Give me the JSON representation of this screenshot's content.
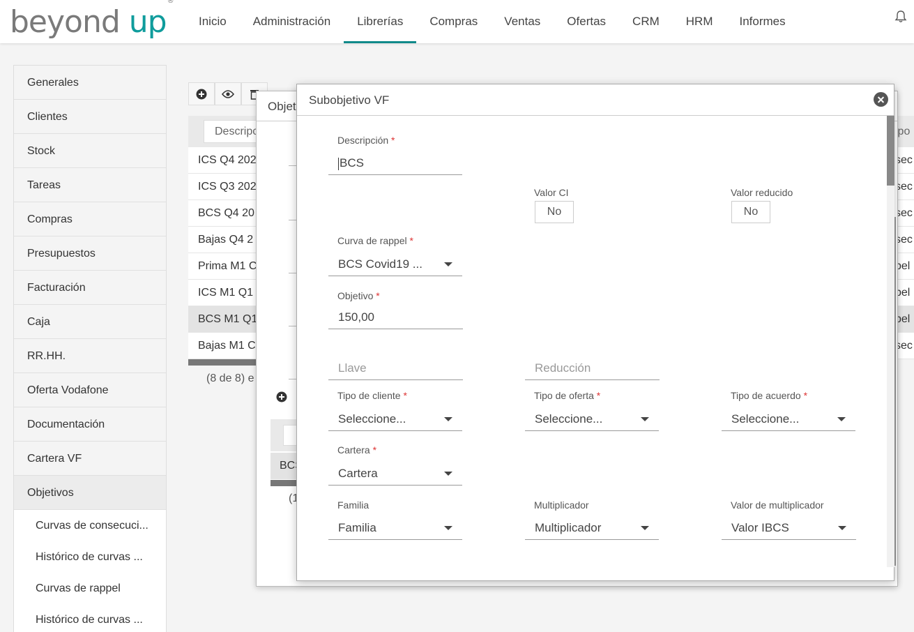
{
  "logo": {
    "part1": "beyond",
    "part2": "up",
    "mark": "®"
  },
  "nav": {
    "items": [
      "Inicio",
      "Administración",
      "Librerías",
      "Compras",
      "Ventas",
      "Ofertas",
      "CRM",
      "HRM",
      "Informes"
    ],
    "active": "Librerías"
  },
  "sidebar": {
    "items": [
      "Generales",
      "Clientes",
      "Stock",
      "Tareas",
      "Compras",
      "Presupuestos",
      "Facturación",
      "Caja",
      "RR.HH.",
      "Oferta Vodafone",
      "Documentación",
      "Cartera VF",
      "Objetivos"
    ],
    "sub_items": [
      "Curvas de consecuci...",
      "Histórico de curvas ...",
      "Curvas de rappel",
      "Histórico de curvas ..."
    ]
  },
  "background": {
    "header_label": "Descripc",
    "right_header": "ipo",
    "rows": [
      "ICS Q4 202",
      "ICS Q3 202",
      "BCS Q4 20",
      "Bajas Q4 2",
      "Prima M1 C",
      "ICS M1 Q1",
      "BCS M1 Q1",
      "Bajas M1 C"
    ],
    "right_cells": [
      "sec",
      "sec",
      "sec",
      "sec",
      "pel",
      "pel",
      "pel",
      "sec"
    ],
    "count": "(8 de 8) e"
  },
  "middle_dialog": {
    "title": "Objet",
    "sub_row": "BCS",
    "sub_count": "(1"
  },
  "dialog": {
    "title": "Subobjetivo VF",
    "required_mark": "*",
    "descripcion": {
      "label": "Descripción",
      "value": "BCS"
    },
    "valor_ci": {
      "label": "Valor CI",
      "value": "No"
    },
    "valor_reducido": {
      "label": "Valor reducido",
      "value": "No"
    },
    "curva_rappel": {
      "label": "Curva de rappel",
      "value": "BCS Covid19 ..."
    },
    "objetivo": {
      "label": "Objetivo",
      "value": "150,00"
    },
    "llave": {
      "placeholder": "Llave"
    },
    "reduccion": {
      "placeholder": "Reducción"
    },
    "tipo_cliente": {
      "label": "Tipo de cliente",
      "value": "Seleccione..."
    },
    "tipo_oferta": {
      "label": "Tipo de oferta",
      "value": "Seleccione..."
    },
    "tipo_acuerdo": {
      "label": "Tipo de acuerdo",
      "value": "Seleccione..."
    },
    "cartera": {
      "label": "Cartera",
      "value": "Cartera"
    },
    "familia": {
      "label": "Familia",
      "value": "Familia"
    },
    "multiplicador": {
      "label": "Multiplicador",
      "value": "Multiplicador"
    },
    "valor_multiplicador": {
      "label": "Valor de multiplicador",
      "value": "Valor IBCS"
    }
  },
  "colors": {
    "brand": "#0f9c9c",
    "accent_underline": "#10898a",
    "required": "#dd3333"
  }
}
